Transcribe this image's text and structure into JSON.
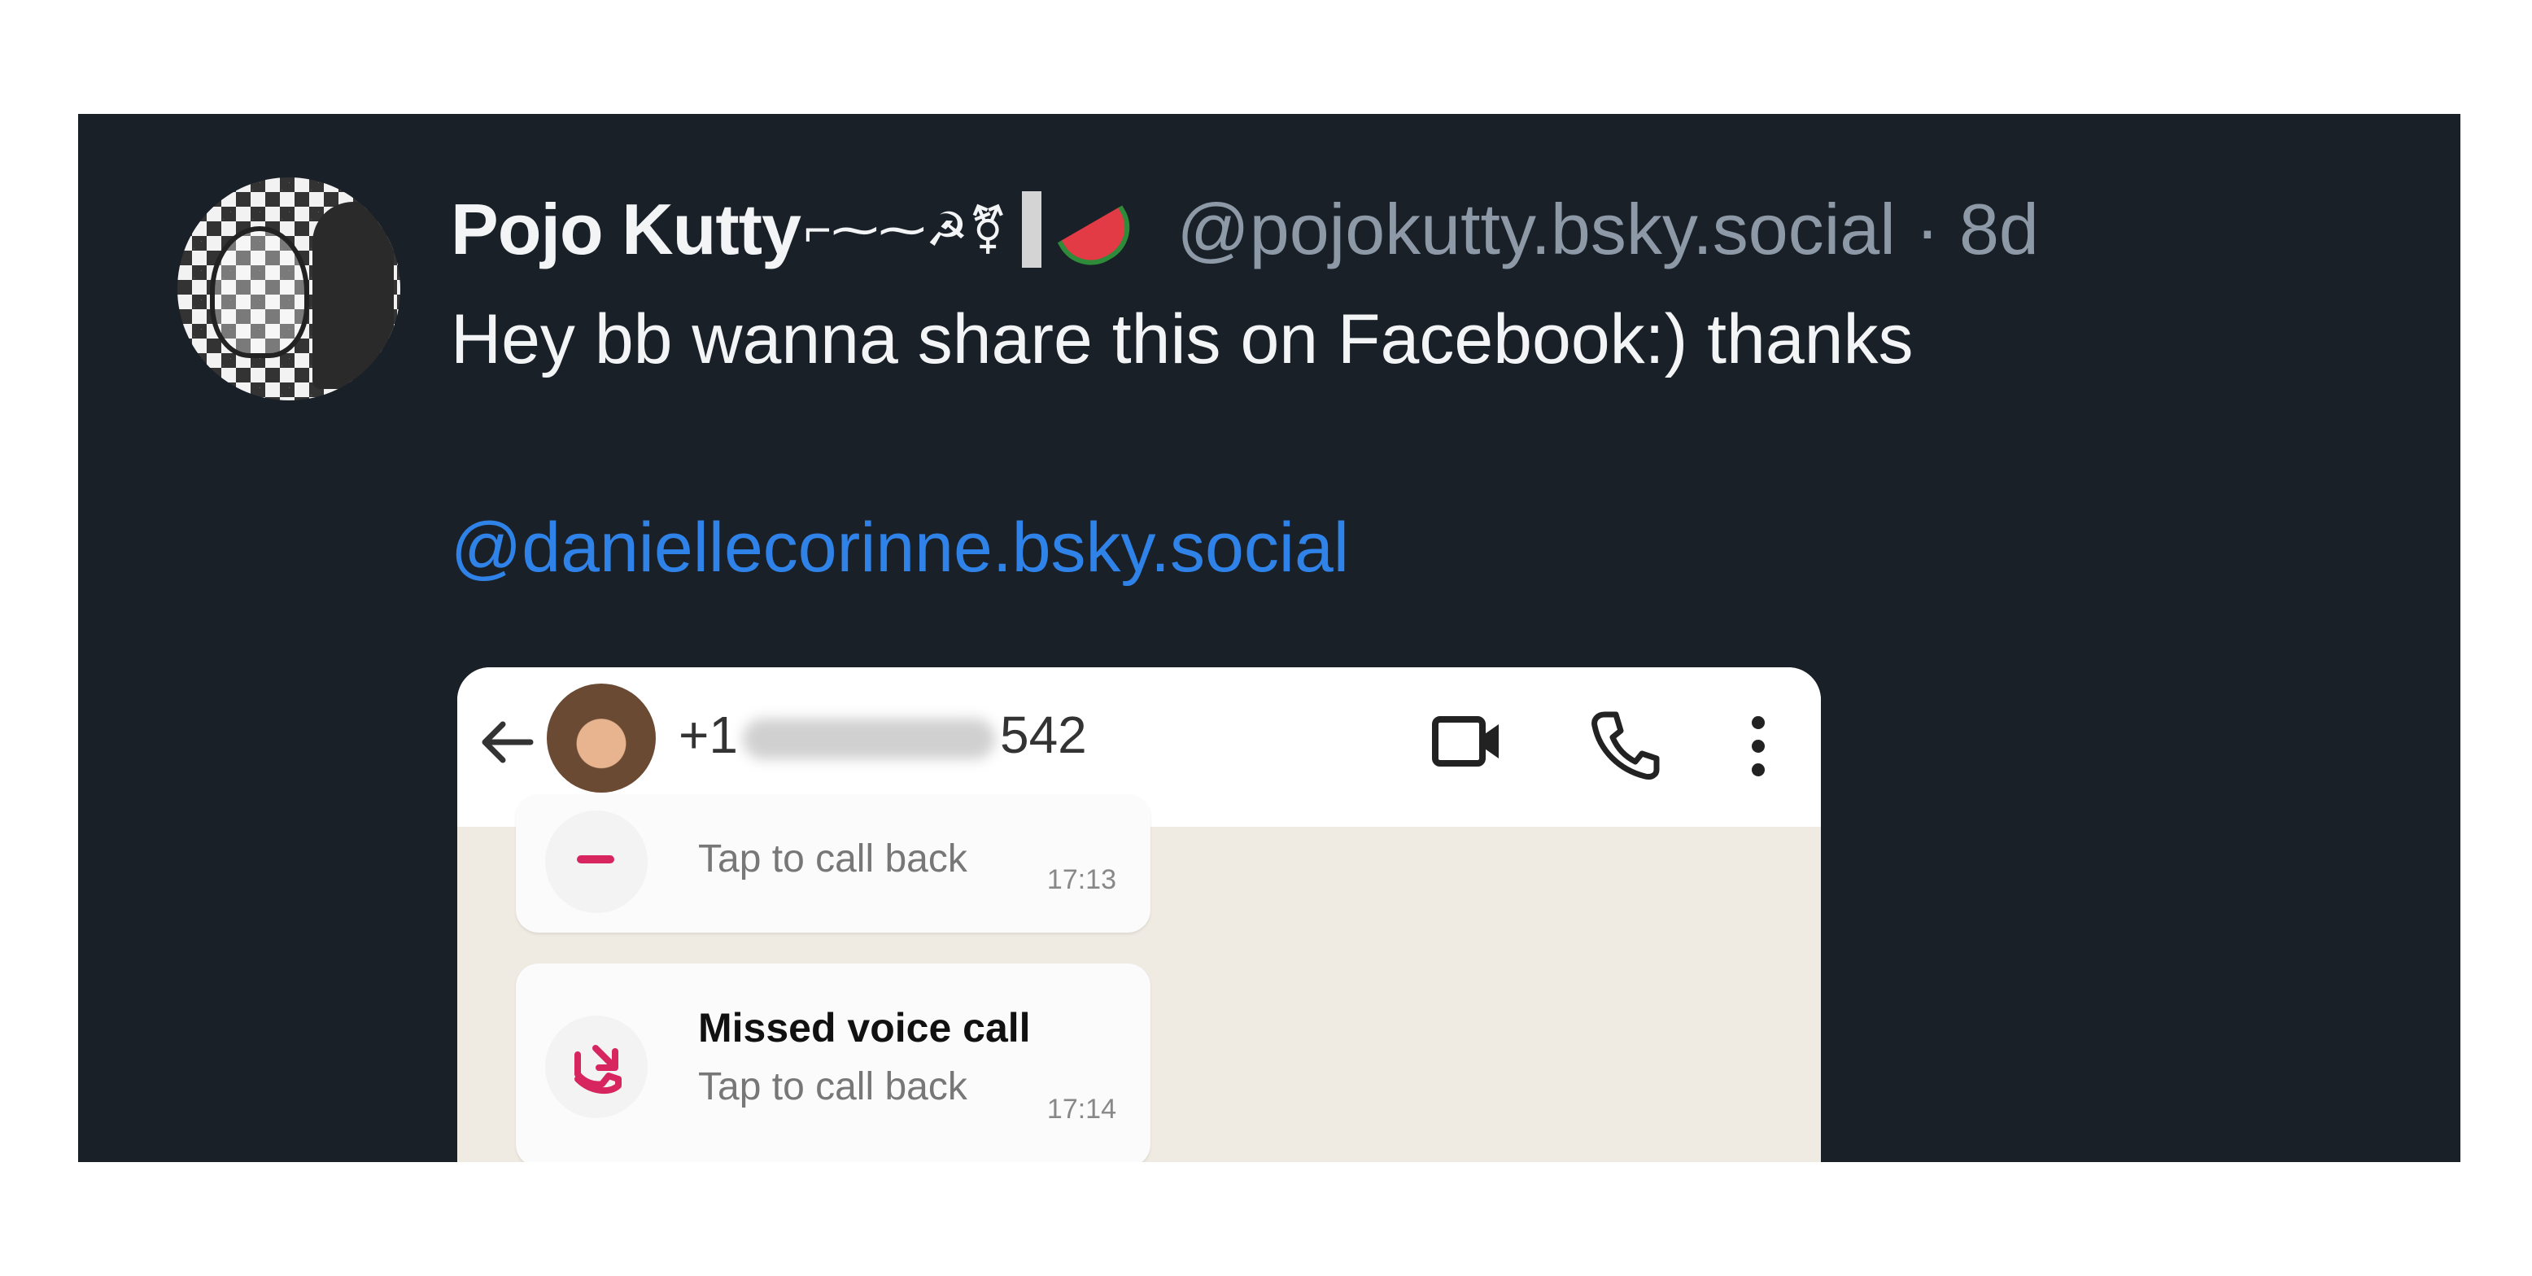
{
  "post": {
    "author_name": "Pojo Kutty",
    "author_name_symbols": "⌐⁓⁓☭⚧",
    "author_handle": "@pojokutty.bsky.social · 8d",
    "text": "Hey bb wanna share this on Facebook:) thanks",
    "mention": "@daniellecorinne.bsky.social"
  },
  "embed": {
    "contact_prefix": "+1",
    "contact_suffix": "542",
    "calls": [
      {
        "title": "",
        "subtitle": "Tap to call back",
        "time": "17:13"
      },
      {
        "title": "Missed voice call",
        "subtitle": "Tap to call back",
        "time": "17:14"
      }
    ]
  },
  "colors": {
    "post_background": "#1a2028",
    "mention_blue": "#2f83e8",
    "handle_gray": "#8d99a6",
    "missed_call_red": "#d6255f",
    "chat_background": "#efeae2"
  },
  "icons": [
    "avatar",
    "back-arrow-icon",
    "video-call-icon",
    "phone-icon",
    "more-options-icon",
    "missed-call-icon",
    "watermelon-icon",
    "flag-icon"
  ]
}
